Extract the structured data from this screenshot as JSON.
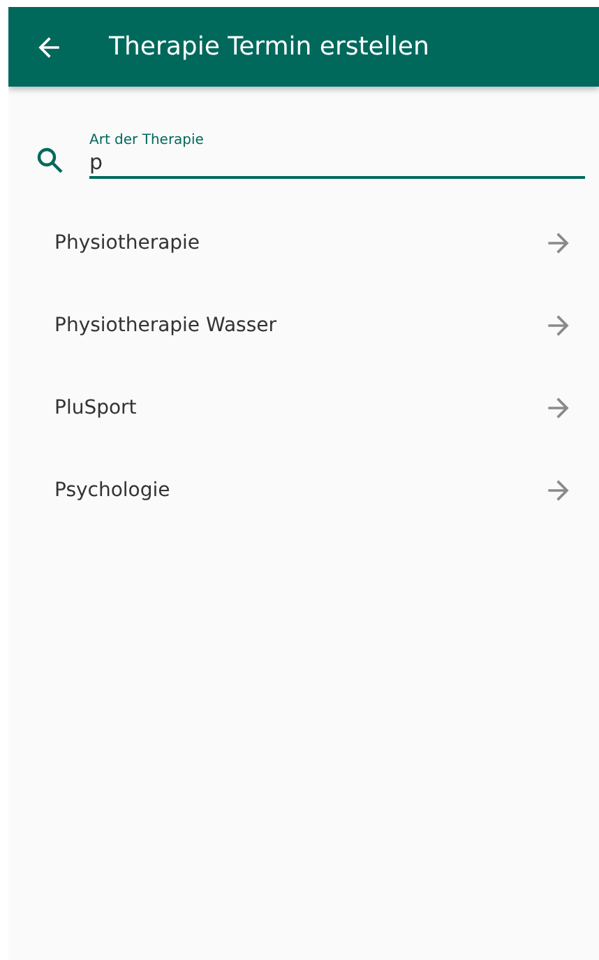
{
  "app_bar": {
    "title": "Therapie Termin erstellen"
  },
  "search": {
    "label": "Art der Therapie",
    "value": "p"
  },
  "results": [
    {
      "label": "Physiotherapie"
    },
    {
      "label": "Physiotherapie Wasser"
    },
    {
      "label": "PluSport"
    },
    {
      "label": "Psychologie"
    }
  ]
}
